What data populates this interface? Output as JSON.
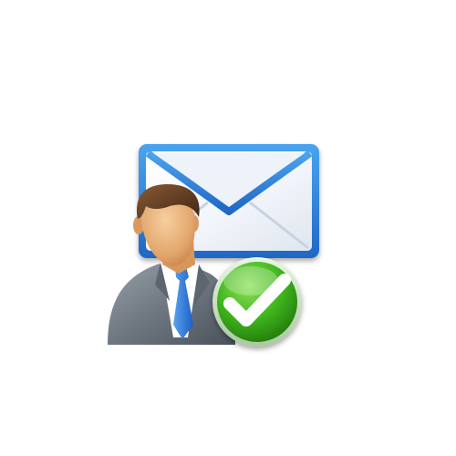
{
  "icon": {
    "name": "user-mail-verified-icon",
    "parts": [
      "envelope-icon",
      "businessman-icon",
      "checkmark-badge-icon"
    ]
  },
  "colors": {
    "background": "#ffffff",
    "envelope_border": "#2f7fd6",
    "envelope_fill": "#f7f9fc",
    "suit": "#6f7780",
    "shirt": "#ffffff",
    "tie": "#2f76d8",
    "skin": "#e8b27a",
    "hair": "#5b3a22",
    "badge_green": "#35a916",
    "check_white": "#ffffff"
  }
}
